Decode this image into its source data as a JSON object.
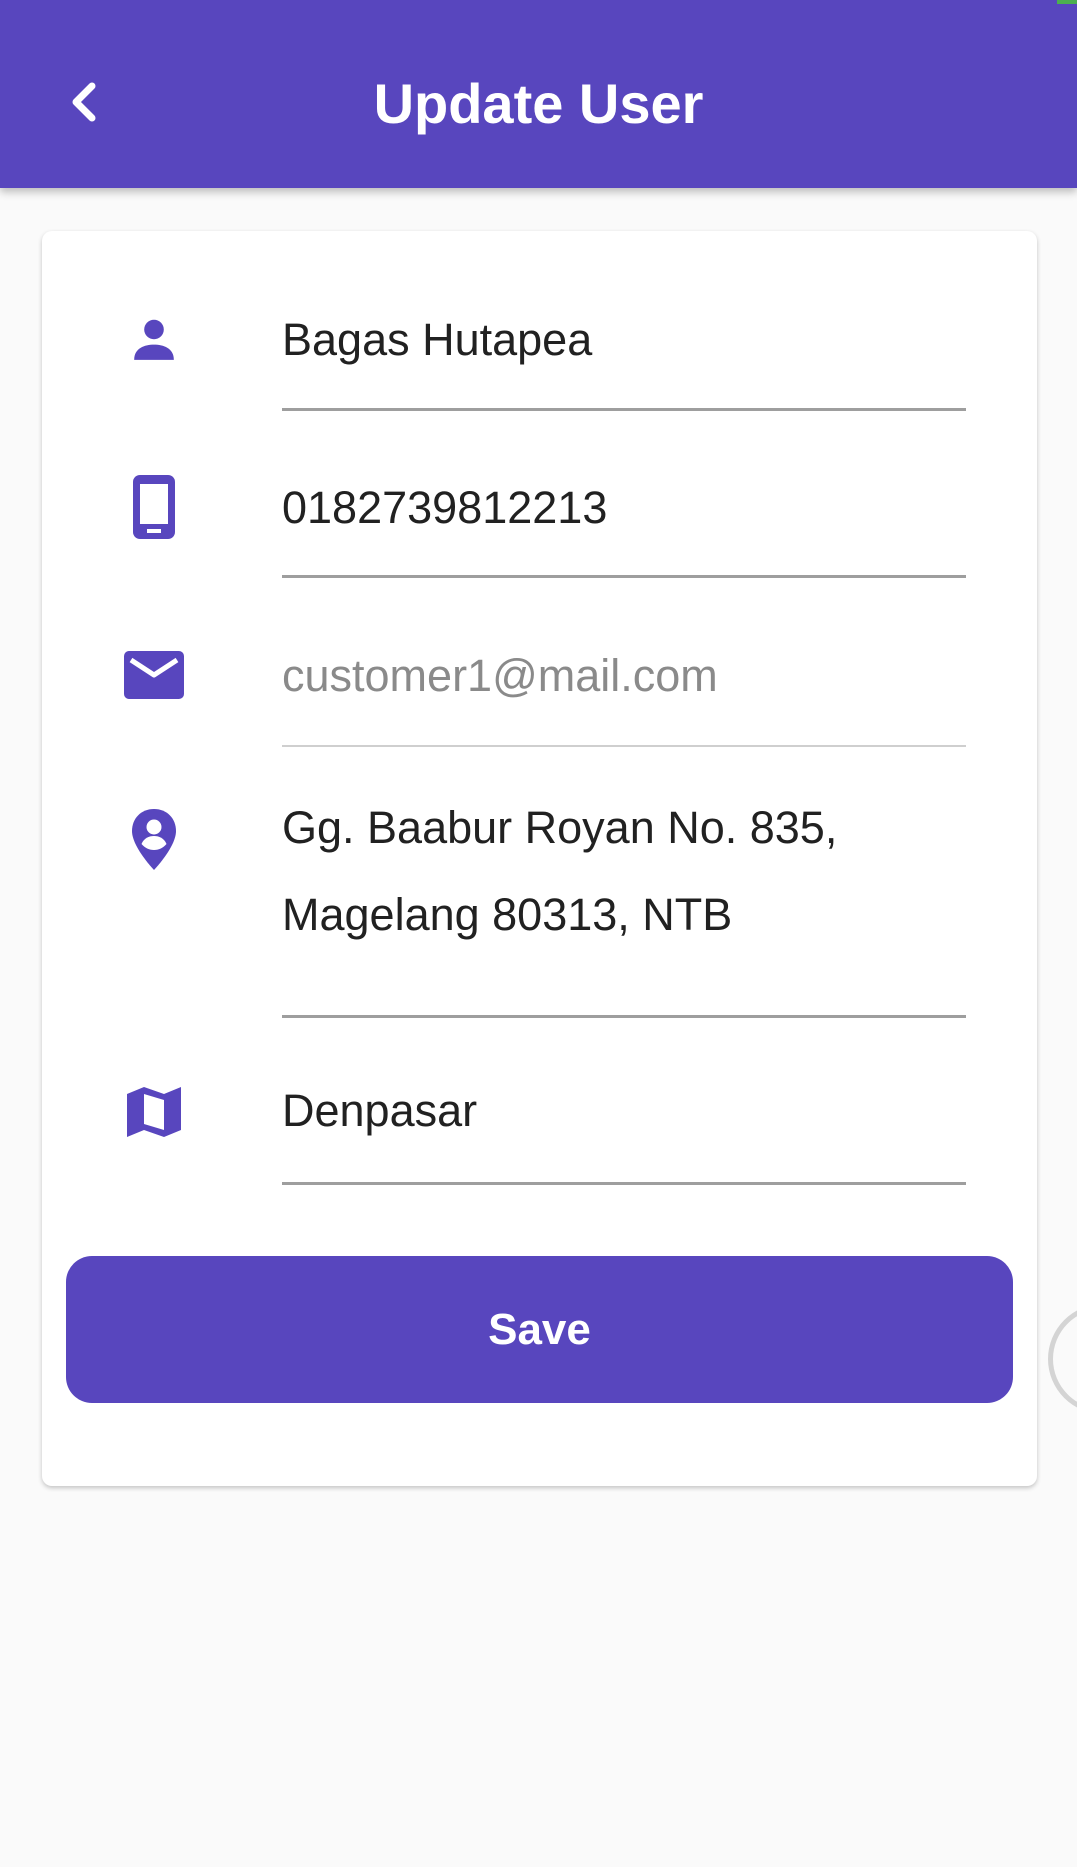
{
  "appbar": {
    "title": "Update User",
    "back_icon": "chevron-left-icon",
    "color": "#5846be"
  },
  "form": {
    "name": {
      "icon": "person-icon",
      "value": "Bagas Hutapea",
      "placeholder": ""
    },
    "phone": {
      "icon": "smartphone-icon",
      "value": "0182739812213",
      "placeholder": ""
    },
    "email": {
      "icon": "mail-icon",
      "value": "",
      "placeholder": "customer1@mail.com"
    },
    "address": {
      "icon": "location-pin-icon",
      "value": "Gg. Baabur Royan No. 835,\nMagelang 80313, NTB"
    },
    "city": {
      "icon": "map-icon",
      "value": "Denpasar",
      "placeholder": ""
    }
  },
  "actions": {
    "save_label": "Save"
  },
  "colors": {
    "accent": "#5846be",
    "background": "#fafafa",
    "card": "#ffffff",
    "text": "#212121",
    "placeholder": "#8a8a8a"
  }
}
